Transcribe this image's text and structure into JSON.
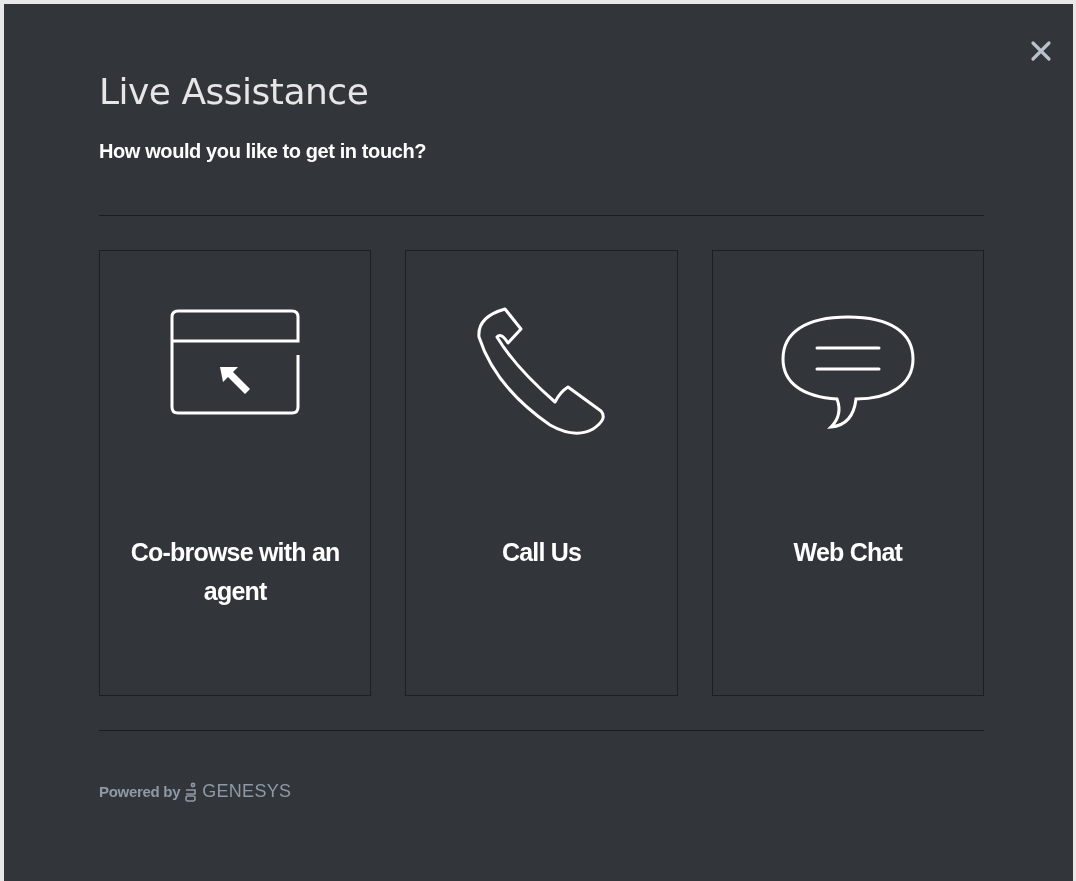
{
  "dialog": {
    "title": "Live Assistance",
    "subtitle": "How would you like to get in touch?"
  },
  "options": [
    {
      "kind": "cobrowse",
      "label": "Co-browse with an agent"
    },
    {
      "kind": "phone",
      "label": "Call Us"
    },
    {
      "kind": "chat",
      "label": "Web Chat"
    }
  ],
  "footer": {
    "powered_by": "Powered by",
    "brand": "GENESYS"
  }
}
